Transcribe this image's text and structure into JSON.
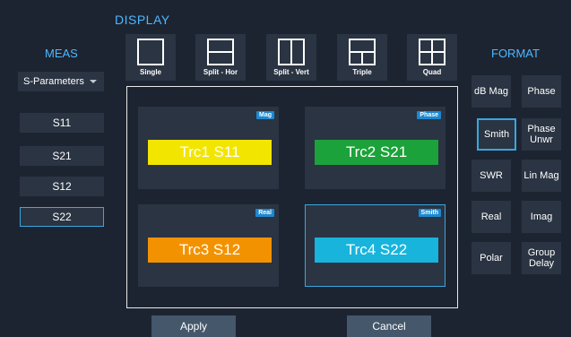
{
  "display": {
    "title": "DISPLAY",
    "layouts": [
      {
        "label": "Single",
        "icon": "single-layout-icon"
      },
      {
        "label": "Split - Hor",
        "icon": "split-horizontal-layout-icon"
      },
      {
        "label": "Split - Vert",
        "icon": "split-vertical-layout-icon"
      },
      {
        "label": "Triple",
        "icon": "triple-layout-icon"
      },
      {
        "label": "Quad",
        "icon": "quad-layout-icon"
      }
    ]
  },
  "meas": {
    "title": "MEAS",
    "parameter_select": "S-Parameters",
    "buttons": [
      "S11",
      "S21",
      "S12",
      "S22"
    ],
    "selected": "S22"
  },
  "traces": [
    {
      "label": "Trc1 S11",
      "badge": "Mag",
      "color": "#f2e500"
    },
    {
      "label": "Trc2 S21",
      "badge": "Phase",
      "color": "#1ca23a"
    },
    {
      "label": "Trc3 S12",
      "badge": "Real",
      "color": "#f39200"
    },
    {
      "label": "Trc4 S22",
      "badge": "Smith",
      "color": "#18b4dc"
    }
  ],
  "format": {
    "title": "FORMAT",
    "buttons": [
      {
        "label": "dB Mag"
      },
      {
        "label": "Phase"
      },
      {
        "label": "Smith"
      },
      {
        "label": "Phase Unwr"
      },
      {
        "label": "SWR"
      },
      {
        "label": "Lin Mag"
      },
      {
        "label": "Real"
      },
      {
        "label": "Imag"
      },
      {
        "label": "Polar"
      },
      {
        "label": "Group Delay"
      }
    ],
    "selected": "Smith"
  },
  "actions": {
    "apply": "Apply",
    "cancel": "Cancel"
  },
  "colors": {
    "accent": "#3aa6e0",
    "title_blue": "#4db8ff",
    "panel": "#2a3442",
    "background": "#1d2431"
  }
}
